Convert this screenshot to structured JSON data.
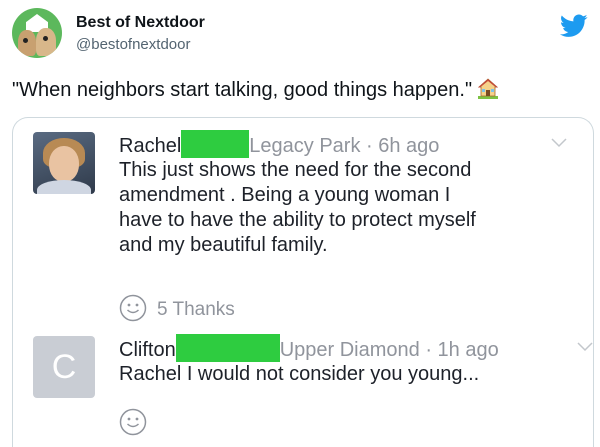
{
  "tweet": {
    "display_name": "Best of Nextdoor",
    "handle": "@bestofnextdoor",
    "text": "\"When neighbors start talking, good things happen.\"",
    "icons": {
      "bird": "twitter-bird-icon",
      "emoji": "house-with-garden-emoji"
    },
    "brand_color": "#1d9bf0"
  },
  "comments": [
    {
      "author": "Rachel",
      "location": "Legacy Park · 6h ago",
      "lines": [
        "This just shows the need for the second",
        "amendment . Being a young woman I",
        "have to have the ability to protect myself",
        "and my beautiful family."
      ],
      "thanks": "5 Thanks"
    },
    {
      "author": "Clifton",
      "location": "Upper Diamond · 1h ago",
      "lines": [
        "Rachel I would not consider you young..."
      ],
      "avatar_letter": "C"
    }
  ],
  "colors": {
    "redaction": "#2ecc40",
    "meta_gray": "#90949c"
  }
}
